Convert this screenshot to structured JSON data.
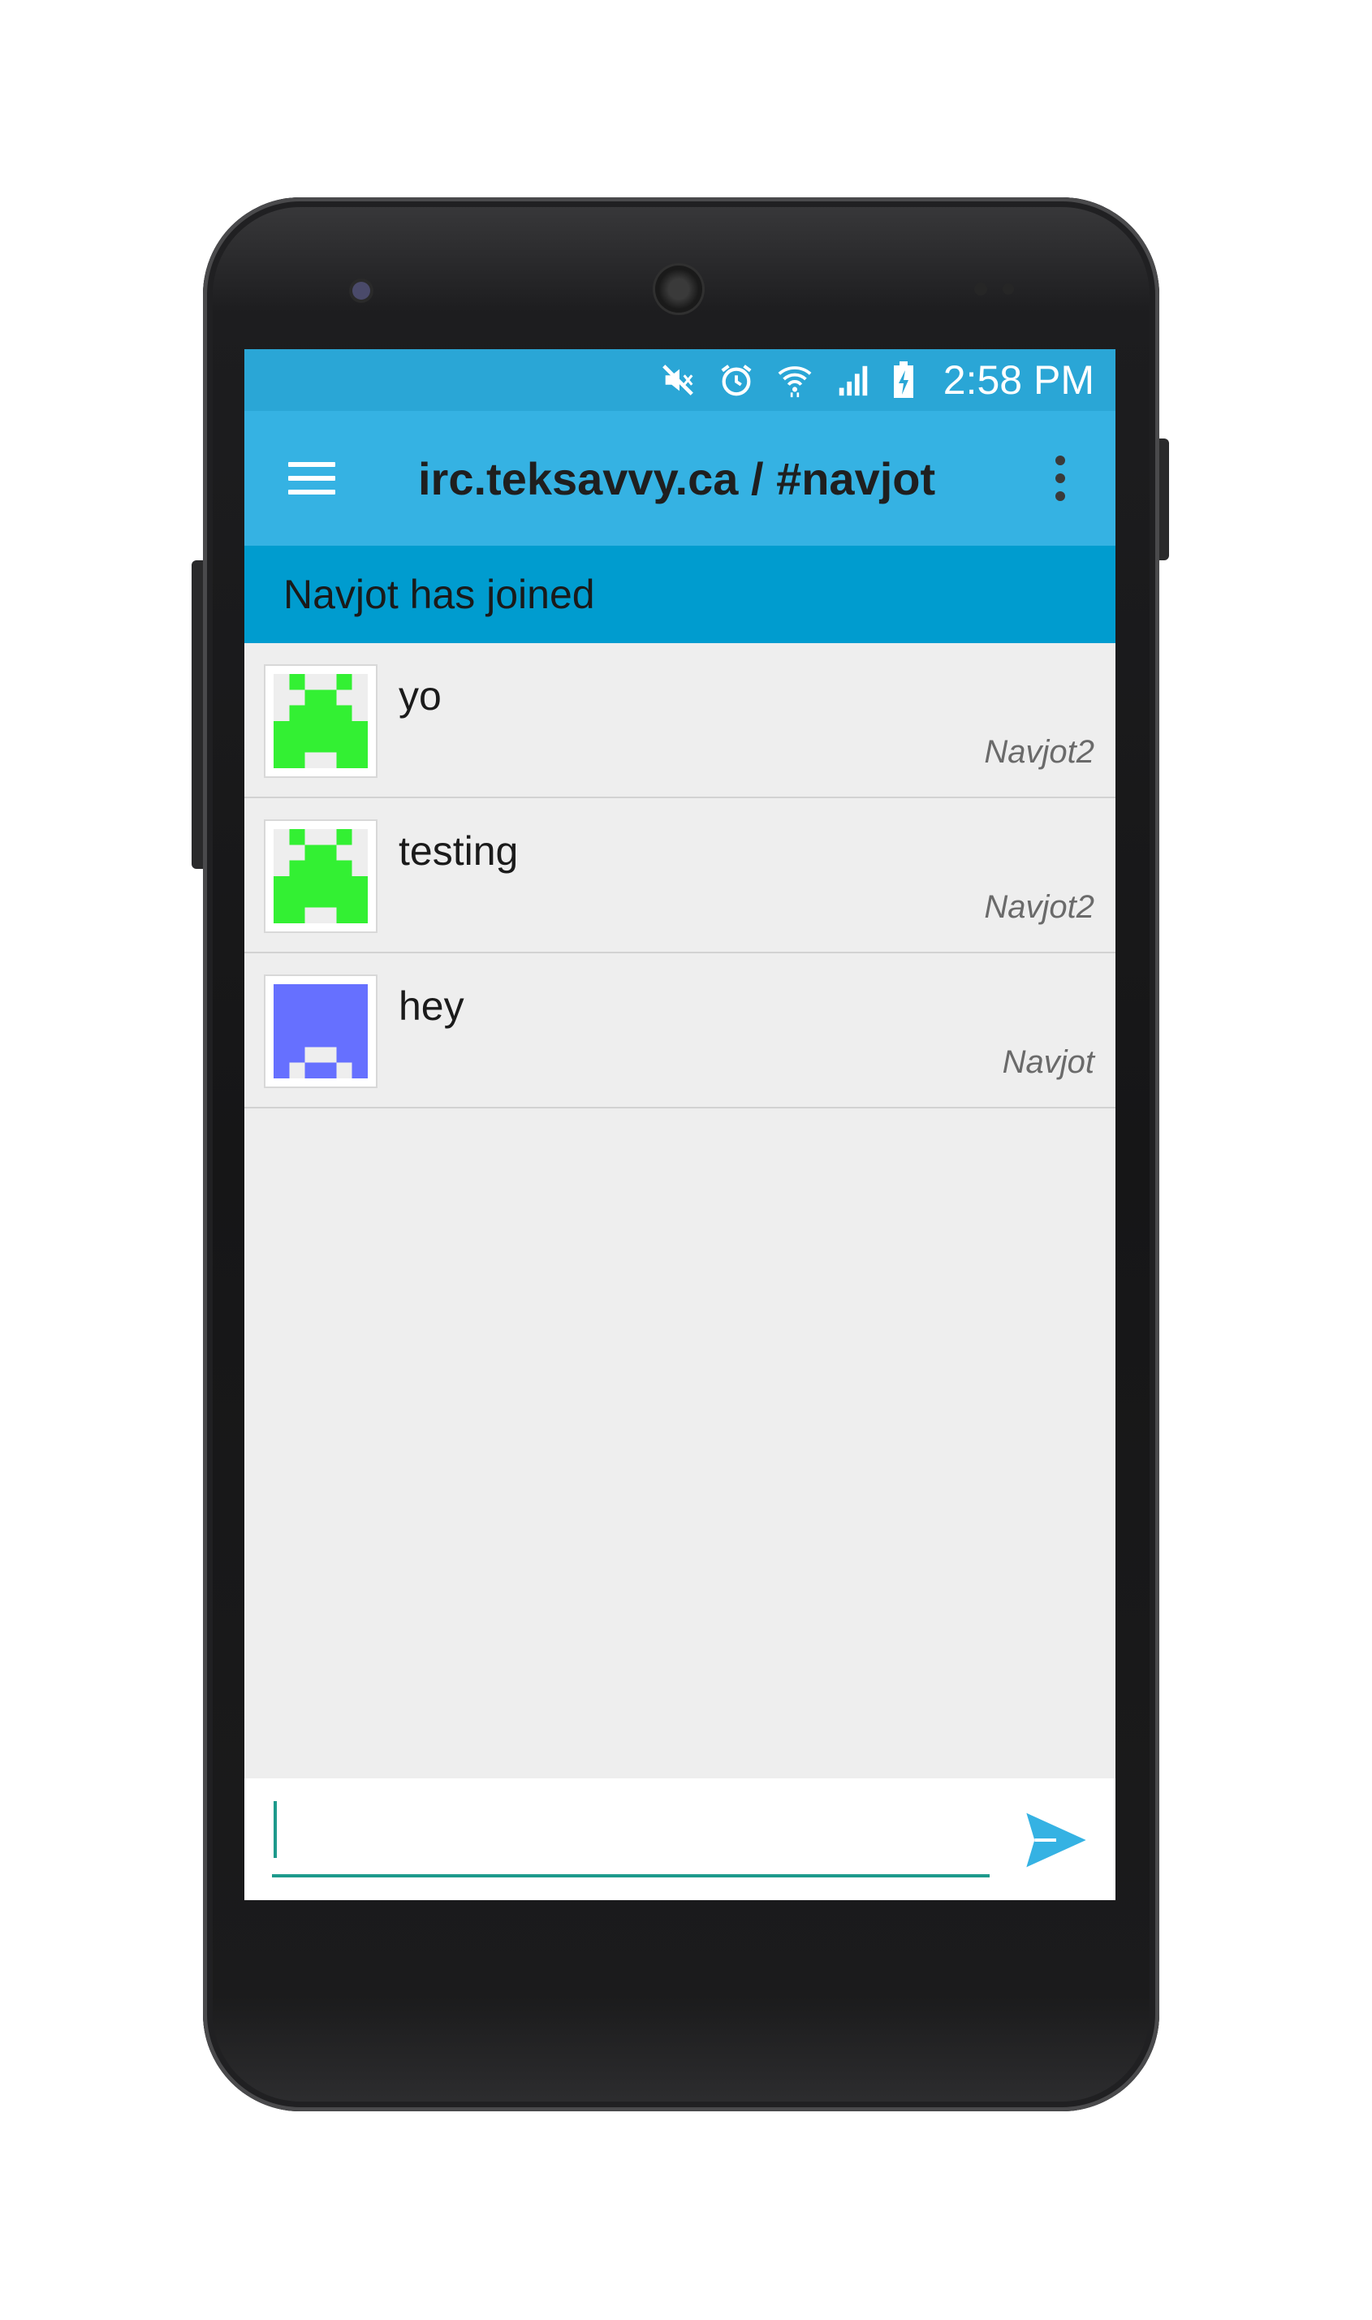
{
  "status_bar": {
    "time": "2:58 PM"
  },
  "app_bar": {
    "title": "irc.teksavvy.ca / #navjot"
  },
  "notice": {
    "text": "Navjot has joined"
  },
  "messages": [
    {
      "text": "yo",
      "nick": "Navjot2",
      "avatar_color": "#33f033"
    },
    {
      "text": "testing",
      "nick": "Navjot2",
      "avatar_color": "#33f033"
    },
    {
      "text": "hey",
      "nick": "Navjot",
      "avatar_color": "#6670ff"
    }
  ],
  "composer": {
    "value": "",
    "placeholder": ""
  },
  "colors": {
    "status_bar": "#2aa6d6",
    "app_bar": "#35b2e3",
    "notice_bar": "#009ccf",
    "send_accent": "#35b2e3",
    "input_underline": "#1d9a8c"
  }
}
